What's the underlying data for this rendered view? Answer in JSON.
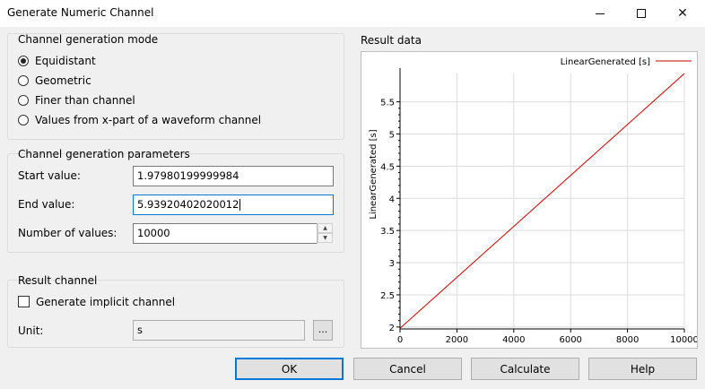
{
  "window": {
    "title": "Generate Numeric Channel",
    "minimize_icon": "minimize-icon",
    "maximize_icon": "maximize-icon",
    "close_icon": "close-icon",
    "close_glyph": "✕"
  },
  "mode_group": {
    "title": "Channel generation mode",
    "options": [
      {
        "label": "Equidistant",
        "selected": true
      },
      {
        "label": "Geometric",
        "selected": false
      },
      {
        "label": "Finer than channel",
        "selected": false
      },
      {
        "label": "Values from x-part of a waveform channel",
        "selected": false
      }
    ]
  },
  "params_group": {
    "title": "Channel generation parameters",
    "start_label": "Start value:",
    "start_value": "1.97980199999984",
    "end_label": "End value:",
    "end_value": "5.93920402020012",
    "count_label": "Number of values:",
    "count_value": "10000"
  },
  "result_group": {
    "title": "Result channel",
    "implicit_label": "Generate implicit channel",
    "implicit_checked": false,
    "unit_label": "Unit:",
    "unit_value": "s",
    "browse_label": "..."
  },
  "buttons": {
    "ok": "OK",
    "cancel": "Cancel",
    "calculate": "Calculate",
    "help": "Help"
  },
  "result_data_title": "Result data",
  "colors": {
    "series": "#cc0000",
    "focus": "#0078d7"
  },
  "chart_data": {
    "type": "line",
    "ylabel": "LinearGenerated [s]",
    "legend_placement": "top-right",
    "grid": true,
    "xlim": [
      0,
      10000
    ],
    "ylim": [
      1.97,
      5.94
    ],
    "x_ticks": [
      0,
      2000,
      4000,
      6000,
      8000,
      10000
    ],
    "x_tick_labels": [
      "0",
      "2000",
      "4000",
      "6000",
      "8000",
      "10000"
    ],
    "y_ticks": [
      2,
      2.5,
      3,
      3.5,
      4,
      4.5,
      5,
      5.5
    ],
    "y_tick_labels": [
      "2",
      "2.5",
      "3",
      "3.5",
      "4",
      "4.5",
      "5",
      "5.5"
    ],
    "series": [
      {
        "name": "LinearGenerated [s]",
        "x": [
          0,
          10000
        ],
        "y": [
          1.9798,
          5.9392
        ]
      }
    ]
  }
}
